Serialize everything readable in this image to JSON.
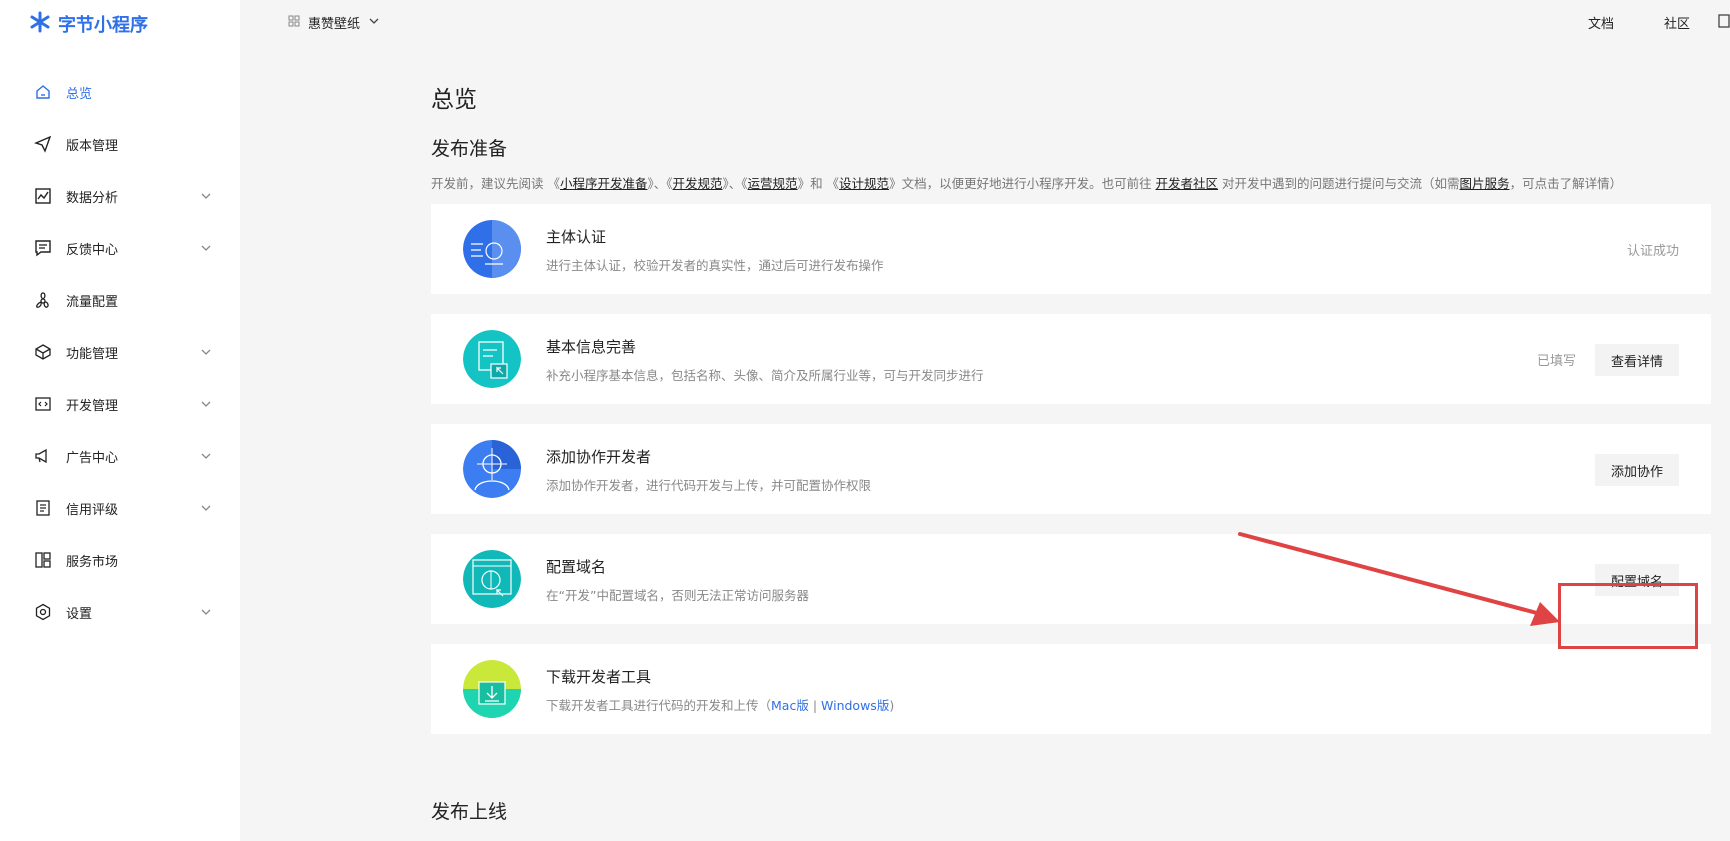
{
  "brand": {
    "name": "字节小程序"
  },
  "sidebar": {
    "items": [
      {
        "label": "总览",
        "icon": "home-icon",
        "active": true,
        "expandable": false
      },
      {
        "label": "版本管理",
        "icon": "send-icon",
        "expandable": false
      },
      {
        "label": "数据分析",
        "icon": "chart-icon",
        "expandable": true
      },
      {
        "label": "反馈中心",
        "icon": "message-icon",
        "expandable": true
      },
      {
        "label": "流量配置",
        "icon": "fan-icon",
        "expandable": false
      },
      {
        "label": "功能管理",
        "icon": "cube-icon",
        "expandable": true
      },
      {
        "label": "开发管理",
        "icon": "code-icon",
        "expandable": true
      },
      {
        "label": "广告中心",
        "icon": "megaphone-icon",
        "expandable": true
      },
      {
        "label": "信用评级",
        "icon": "list-icon",
        "expandable": true
      },
      {
        "label": "服务市场",
        "icon": "grid-icon",
        "expandable": false
      },
      {
        "label": "设置",
        "icon": "settings-icon",
        "expandable": true
      }
    ]
  },
  "topbar": {
    "app_name": "惠赞壁纸",
    "docs": "文档",
    "community": "社区"
  },
  "main": {
    "page_title": "总览",
    "section_title": "发布准备",
    "intro": {
      "p1": "开发前，建议先阅读 《",
      "l1": "小程序开发准备",
      "p2": "》、《",
      "l2": "开发规范",
      "p3": "》、《",
      "l3": "运营规范",
      "p4": "》和 《",
      "l4": "设计规范",
      "p5": "》文档，以便更好地进行小程序开发。也可前往 ",
      "l5": "开发者社区",
      "p6": " 对开发中遇到的问题进行提问与交流（如需",
      "l6": "图片服务",
      "p7": "，可点击了解详情）"
    },
    "cards": [
      {
        "title": "主体认证",
        "desc": "进行主体认证，校验开发者的真实性，通过后可进行发布操作",
        "status": "认证成功"
      },
      {
        "title": "基本信息完善",
        "desc": "补充小程序基本信息，包括名称、头像、简介及所属行业等，可与开发同步进行",
        "status": "已填写",
        "button": "查看详情"
      },
      {
        "title": "添加协作开发者",
        "desc": "添加协作开发者，进行代码开发与上传，并可配置协作权限",
        "button": "添加协作"
      },
      {
        "title": "配置域名",
        "desc": "在“开发”中配置域名，否则无法正常访问服务器",
        "button": "配置域名"
      },
      {
        "title": "下载开发者工具",
        "desc_prefix": "下载开发者工具进行代码的开发和上传（",
        "mac": "Mac版",
        "sep": " | ",
        "win": "Windows版",
        "desc_suffix": ")"
      }
    ],
    "section2_title": "发布上线"
  },
  "colors": {
    "accent": "#2f6fe8",
    "highlight": "#e04343"
  }
}
